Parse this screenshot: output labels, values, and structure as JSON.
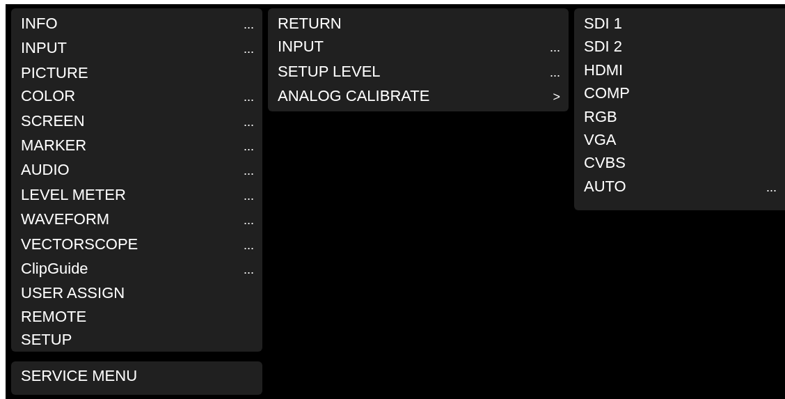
{
  "menus": [
    {
      "items": [
        {
          "label": "INFO",
          "suffix": "..."
        },
        {
          "label": "INPUT",
          "suffix": "..."
        },
        {
          "label": "PICTURE"
        },
        {
          "label": "COLOR",
          "suffix": "..."
        },
        {
          "label": "SCREEN",
          "suffix": "..."
        },
        {
          "label": "MARKER",
          "suffix": "..."
        },
        {
          "label": "AUDIO",
          "suffix": "..."
        },
        {
          "label": "LEVEL METER",
          "suffix": "..."
        },
        {
          "label": "WAVEFORM",
          "suffix": "..."
        },
        {
          "label": "VECTORSCOPE",
          "suffix": "..."
        },
        {
          "label": "ClipGuide",
          "suffix": "..."
        },
        {
          "label": "USER ASSIGN"
        },
        {
          "label": "REMOTE"
        },
        {
          "label": "SETUP"
        }
      ]
    },
    {
      "items": [
        {
          "label": "SERVICE MENU"
        }
      ]
    },
    {
      "items": [
        {
          "label": "RETURN"
        },
        {
          "label": "INPUT",
          "suffix": "..."
        },
        {
          "label": "SETUP LEVEL",
          "suffix": "..."
        },
        {
          "label": "ANALOG CALIBRATE",
          "suffix": ">"
        }
      ]
    },
    {
      "items": [
        {
          "label": "SDI 1"
        },
        {
          "label": "SDI 2"
        },
        {
          "label": "HDMI"
        },
        {
          "label": "COMP"
        },
        {
          "label": "RGB"
        },
        {
          "label": "VGA"
        },
        {
          "label": "CVBS"
        },
        {
          "label": "AUTO",
          "suffix": "..."
        }
      ]
    }
  ]
}
